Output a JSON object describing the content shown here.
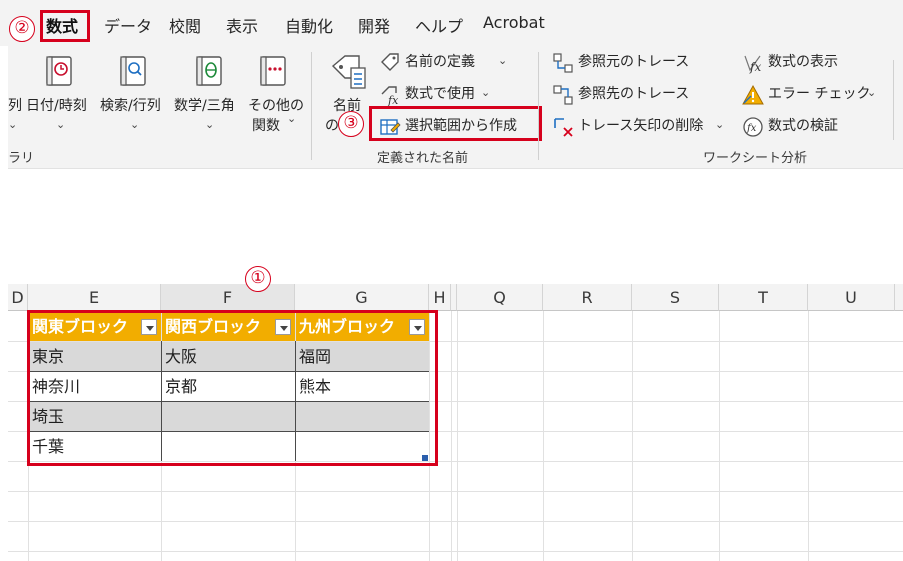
{
  "menu": {
    "badge": "②",
    "tabs": [
      "数式",
      "データ",
      "校閲",
      "表示",
      "自動化",
      "開発",
      "ヘルプ",
      "Acrobat"
    ]
  },
  "ribbon": {
    "library": {
      "partial_label": "列",
      "group_label_partial": "ラリ",
      "datetime": "日付/時刻",
      "lookup": "検索/行列",
      "math_line1": "数学/三角",
      "other_line1": "その他の",
      "other_line2": "関数"
    },
    "defined_names": {
      "name_mgr_line1": "名前",
      "name_mgr_line2": "の",
      "define_name": "名前の定義",
      "use_in_formula": "数式で使用",
      "create_from_selection": "選択範囲から作成",
      "badge": "③",
      "group_label": "定義された名前"
    },
    "auditing": {
      "trace_precedents": "参照元のトレース",
      "trace_dependents": "参照先のトレース",
      "remove_arrows": "トレース矢印の削除",
      "show_formulas": "数式の表示",
      "error_checking": "エラー チェック",
      "evaluate_formula": "数式の検証",
      "group_label": "ワークシート分析"
    },
    "colors": {
      "highlight": "#d6001c",
      "accent_orange": "#f2ad00"
    }
  },
  "sheet": {
    "badge": "①",
    "columns": [
      "D",
      "E",
      "F",
      "G",
      "H",
      "Q",
      "R",
      "S",
      "T",
      "U"
    ],
    "table": {
      "headers": [
        "関東ブロック",
        "関西ブロック",
        "九州ブロック"
      ],
      "rows": [
        [
          "東京",
          "大阪",
          "福岡"
        ],
        [
          "神奈川",
          "京都",
          "熊本"
        ],
        [
          "埼玉",
          "",
          ""
        ],
        [
          "千葉",
          "",
          ""
        ]
      ]
    }
  }
}
